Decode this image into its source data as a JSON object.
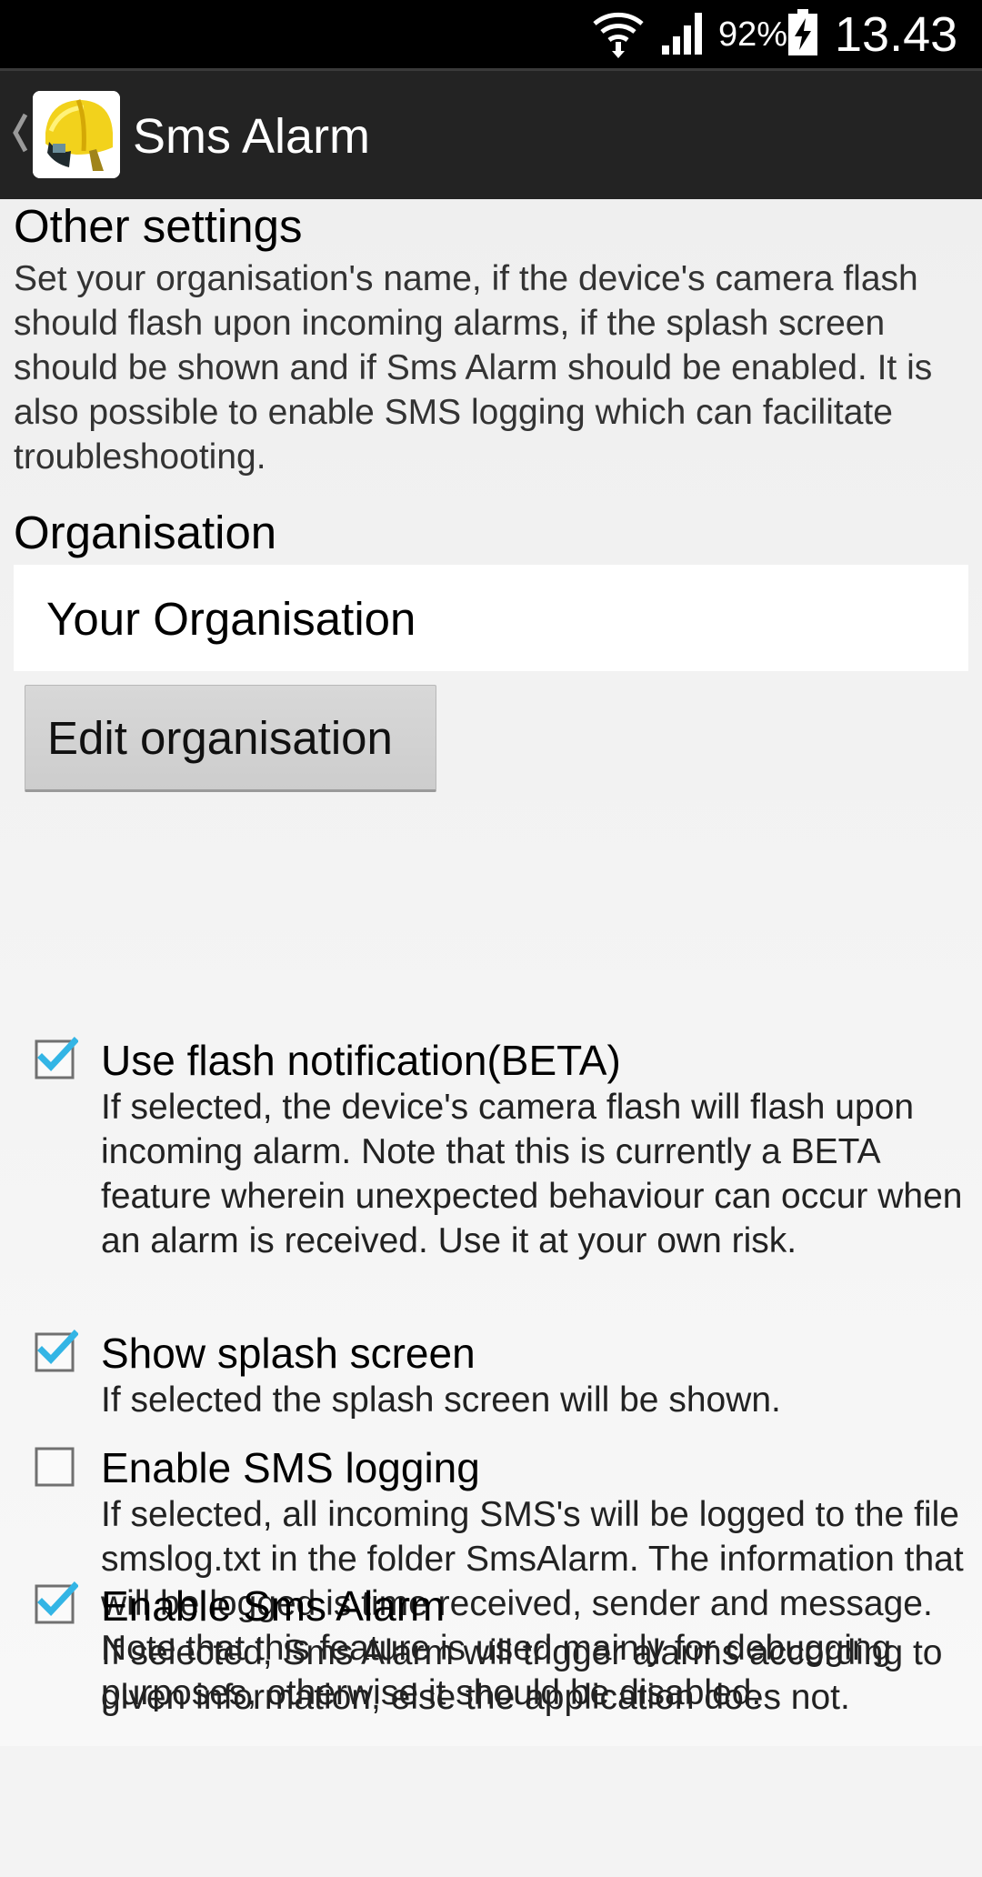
{
  "status_bar": {
    "battery_percent": "92%",
    "time": "13.43",
    "icons": [
      "wifi-icon",
      "signal-icon",
      "battery-charging-icon"
    ]
  },
  "action_bar": {
    "title": "Sms Alarm",
    "app_icon": "firefighter-helmet-icon"
  },
  "other_settings": {
    "heading": "Other settings",
    "description": "Set your organisation's name, if the device's camera flash should flash upon incoming alarms, if the splash screen should be shown and if Sms Alarm should be enabled. It is also possible to enable SMS logging which can facilitate troubleshooting."
  },
  "organisation": {
    "heading": "Organisation",
    "value": "Your Organisation",
    "edit_button": "Edit organisation"
  },
  "preferences": [
    {
      "title": "Use flash notification(BETA)",
      "summary": "If selected, the device's camera flash will flash upon incoming alarm. Note that this is currently a BETA feature wherein unexpected behaviour can occur when an alarm is received. Use it at your own risk.",
      "checked": true
    },
    {
      "title": "Show splash screen",
      "summary": "If selected the splash screen will be shown.",
      "checked": true
    },
    {
      "title": "Enable SMS logging",
      "summary": "If selected, all incoming SMS's will be logged to the file smslog.txt in the folder SmsAlarm. The information that will be logged is time received, sender and message. Note that this feature is used mainly for debugging purposes, otherwise it should be disabled.",
      "checked": false
    },
    {
      "title": "Enable Sms Alarm",
      "summary": "If selected, Sms Alarm will trigger alarms according to given information, else the application does not.",
      "checked": true
    }
  ],
  "colors": {
    "accent": "#33b5e5",
    "action_bar": "#232323",
    "background": "#f3f3f3"
  }
}
